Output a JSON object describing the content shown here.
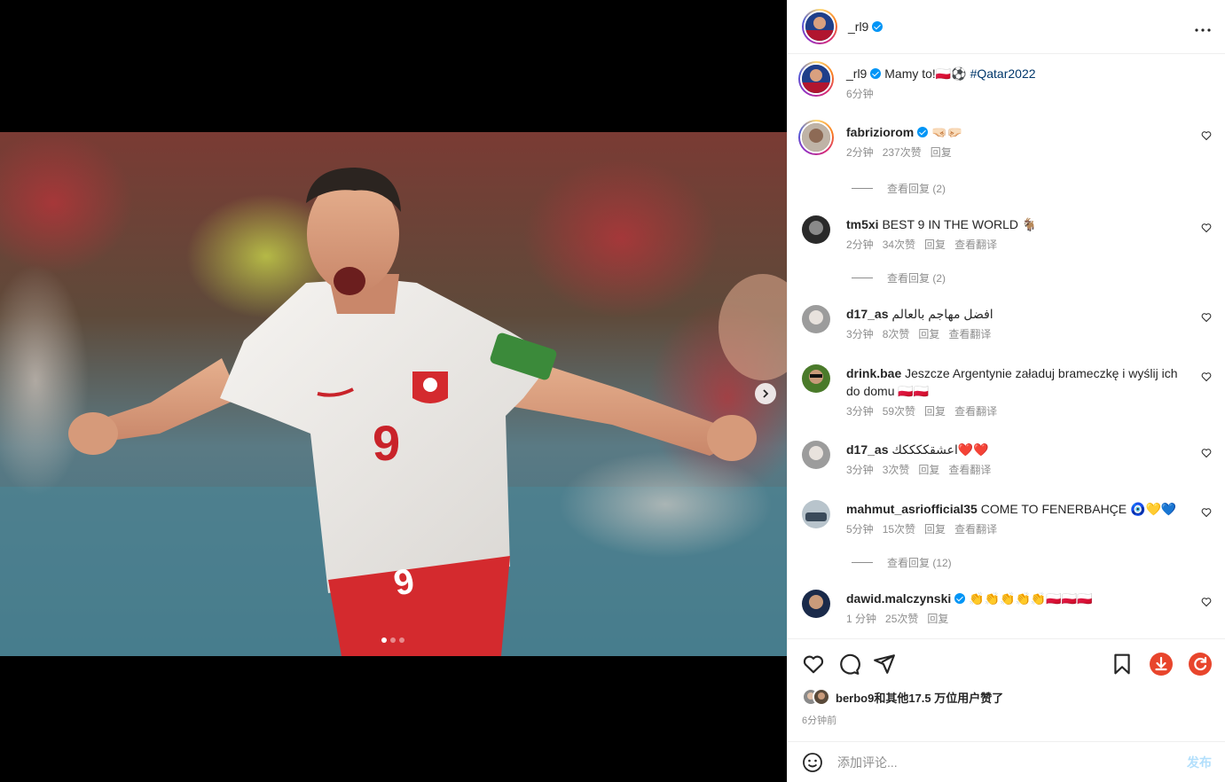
{
  "post": {
    "author": "_rl9",
    "more_icon": "more-horizontal-icon"
  },
  "caption": {
    "user": "_rl9",
    "text": " Mamy to!🇵🇱⚽ ",
    "hashtag": "#Qatar2022",
    "time": "6分钟"
  },
  "comments": [
    {
      "user": "fabriziorom",
      "verified": true,
      "text": " 🤜🏻🤛🏻",
      "time": "2分钟",
      "likes": "237次赞",
      "reply": "回复",
      "translate": ""
    },
    {
      "user": "tm5xi",
      "verified": false,
      "text": " BEST 9 IN THE WORLD 🐐",
      "time": "2分钟",
      "likes": "34次赞",
      "reply": "回复",
      "translate": "查看翻译"
    },
    {
      "user": "d17_as",
      "verified": false,
      "text": " افضل مهاجم بالعالم",
      "time": "3分钟",
      "likes": "8次赞",
      "reply": "回复",
      "translate": "查看翻译"
    },
    {
      "user": "drink.bae",
      "verified": false,
      "text": " Jeszcze Argentynie załaduj brameczkę i wyślij ich do domu 🇵🇱🇵🇱",
      "time": "3分钟",
      "likes": "59次赞",
      "reply": "回复",
      "translate": "查看翻译"
    },
    {
      "user": "d17_as",
      "verified": false,
      "text": " اعشقككككك❤️❤️",
      "time": "3分钟",
      "likes": "3次赞",
      "reply": "回复",
      "translate": "查看翻译"
    },
    {
      "user": "mahmut_asriofficial35",
      "verified": false,
      "text": " COME TO FENERBAHÇE 🧿💛💙",
      "time": "5分钟",
      "likes": "15次赞",
      "reply": "回复",
      "translate": "查看翻译"
    },
    {
      "user": "dawid.malczynski",
      "verified": true,
      "text": " 👏👏👏👏👏🇵🇱🇵🇱🇵🇱",
      "time": "1 分钟",
      "likes": "25次赞",
      "reply": "回复",
      "translate": ""
    }
  ],
  "view_replies": [
    "查看回复 (2)",
    "查看回复 (2)",
    "查看回复 (12)"
  ],
  "likes": {
    "text": "berbo9和其他17.5 万位用户赞了",
    "time": "6分钟前"
  },
  "add_comment": {
    "placeholder": "添加评论...",
    "post_label": "发布"
  },
  "colors": {
    "accent": "#0095f6",
    "hashtag": "#00376b",
    "download_badge": "#e8452c",
    "muted_text": "#8e8e8e"
  },
  "icons": [
    "like-icon",
    "comment-icon",
    "share-icon",
    "save-icon",
    "download-icon",
    "refresh-icon",
    "emoji-icon",
    "chevron-right-icon"
  ]
}
